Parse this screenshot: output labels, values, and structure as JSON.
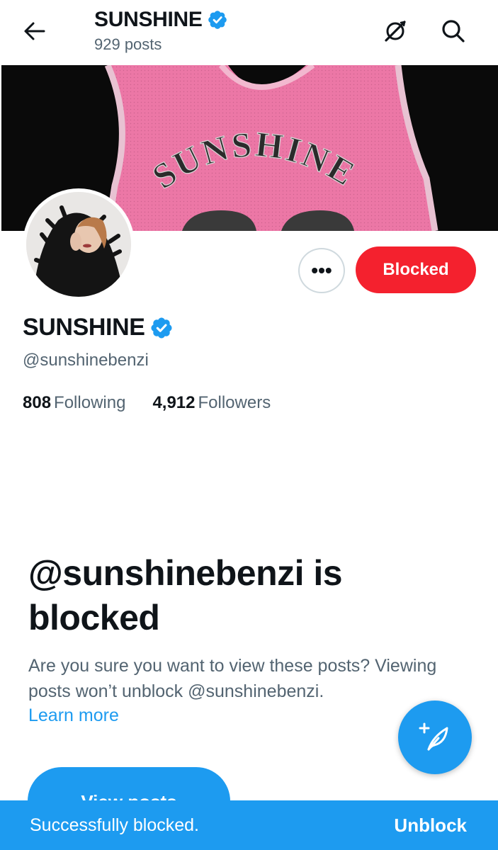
{
  "header": {
    "title": "SUNSHINE",
    "posts_count": "929 posts",
    "back_icon": "arrow-left-icon",
    "premium_icon": "premium-icon",
    "search_icon": "search-icon"
  },
  "banner": {
    "jersey_text": "SUNSHINE",
    "colors": {
      "jersey": "#ec77a6",
      "background": "#0a0a0a"
    }
  },
  "profile": {
    "name": "SUNSHINE",
    "handle": "@sunshinebenzi",
    "following_count": "808",
    "following_label": "Following",
    "followers_count": "4,912",
    "followers_label": "Followers",
    "verified_color": "#1d9bf0"
  },
  "actions": {
    "more_label": "•••",
    "blocked_label": "Blocked",
    "blocked_color": "#f4212e"
  },
  "blocked_notice": {
    "title": "@sunshinebenzi is blocked",
    "description": "Are you sure you want to view these posts? Viewing posts won’t unblock @sunshinebenzi.",
    "learn_more": "Learn more",
    "view_posts_label": "View posts"
  },
  "fab": {
    "icon": "compose-post-icon"
  },
  "toast": {
    "message": "Successfully blocked.",
    "action": "Unblock",
    "color": "#1d9bf0"
  }
}
